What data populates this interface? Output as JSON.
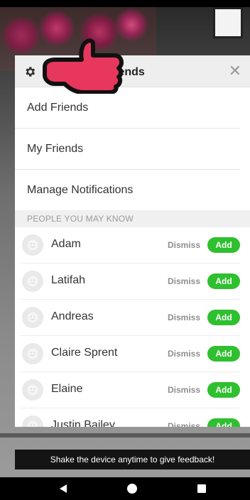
{
  "modal": {
    "title": "Friends",
    "close_glyph": "✕"
  },
  "menu": [
    {
      "label": "Add Friends"
    },
    {
      "label": "My Friends"
    },
    {
      "label": "Manage Notifications"
    }
  ],
  "people_section": {
    "header": "PEOPLE YOU MAY KNOW",
    "dismiss_label": "Dismiss",
    "add_label": "Add",
    "people": [
      {
        "name": "Adam"
      },
      {
        "name": "Latifah"
      },
      {
        "name": "Andreas"
      },
      {
        "name": "Claire Sprent"
      },
      {
        "name": "Elaine"
      },
      {
        "name": "Justin Bailey"
      }
    ]
  },
  "toast": "Shake the device anytime to give feedback!",
  "colors": {
    "accent_add": "#2fc02f",
    "pointer_hand": "#e8375c"
  },
  "icons": [
    "gear-icon",
    "close-icon",
    "pointing-hand-icon",
    "avatar-placeholder-icon",
    "back-icon",
    "home-icon",
    "recents-icon"
  ]
}
